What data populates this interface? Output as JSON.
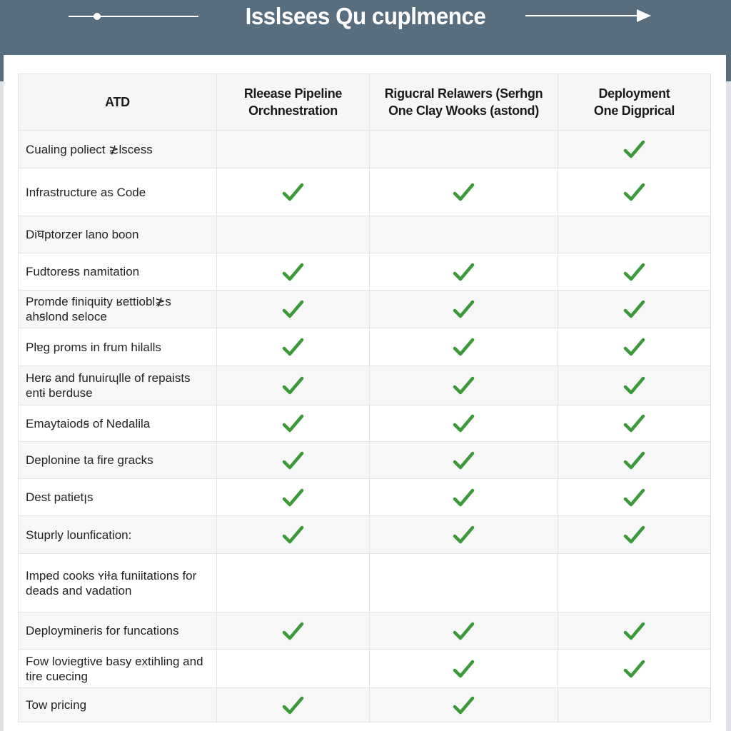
{
  "header": {
    "title": "Isslsees Qu cuplmence",
    "left_decoration_icon": "slider-line-icon",
    "right_decoration_icon": "arrow-right-icon"
  },
  "colors": {
    "band": "#586d7e",
    "check": "#3a9a3a",
    "title_text": "#ffffff"
  },
  "table": {
    "columns": [
      {
        "label": "ATD"
      },
      {
        "label": "Rleease Pipeline\nOrchnestration"
      },
      {
        "label": "Rigucral Relawers (Serhgn\nOne Clay Wooks (astond)"
      },
      {
        "label": "Deployment\nOne Digprical"
      }
    ],
    "rows": [
      {
        "feature": "Cualing poliect ≵lscess",
        "checks": [
          false,
          false,
          true
        ]
      },
      {
        "feature": "Infrastructure as Code",
        "checks": [
          true,
          true,
          true
        ]
      },
      {
        "feature": "Diघptorzer lano boon",
        "checks": [
          false,
          false,
          false
        ]
      },
      {
        "feature": "Fudtoreꞩs namitation",
        "checks": [
          true,
          true,
          true
        ]
      },
      {
        "feature": "Promde finiquity ʁettiobl≵s ahꞩlond seloce",
        "checks": [
          true,
          true,
          true
        ]
      },
      {
        "feature": "Plɐg proms in frum hilalls",
        "checks": [
          true,
          true,
          true
        ]
      },
      {
        "feature": "Herɕ and funuiɾɰlle of repaists entɨ berduse",
        "checks": [
          true,
          true,
          true
        ]
      },
      {
        "feature": "Emaytaiodꞩ of Nedalila",
        "checks": [
          true,
          true,
          true
        ]
      },
      {
        "feature": "Deplonine ta fire gracks",
        "checks": [
          true,
          true,
          true
        ]
      },
      {
        "feature": "Dest patietꞁs",
        "checks": [
          true,
          true,
          true
        ]
      },
      {
        "feature": "Stuprly lounfication:",
        "checks": [
          true,
          true,
          true
        ]
      },
      {
        "feature": "Imped cooks ʏiɫa funiitations for deads and vadation",
        "checks": [
          false,
          false,
          false
        ]
      },
      {
        "feature": "Deploymineris for funcations",
        "checks": [
          true,
          true,
          true
        ]
      },
      {
        "feature": "Fow loviegtive basy extihling and tire cuecing",
        "checks": [
          false,
          true,
          true
        ]
      },
      {
        "feature": "Tow pricing",
        "checks": [
          true,
          true,
          false
        ]
      }
    ]
  }
}
